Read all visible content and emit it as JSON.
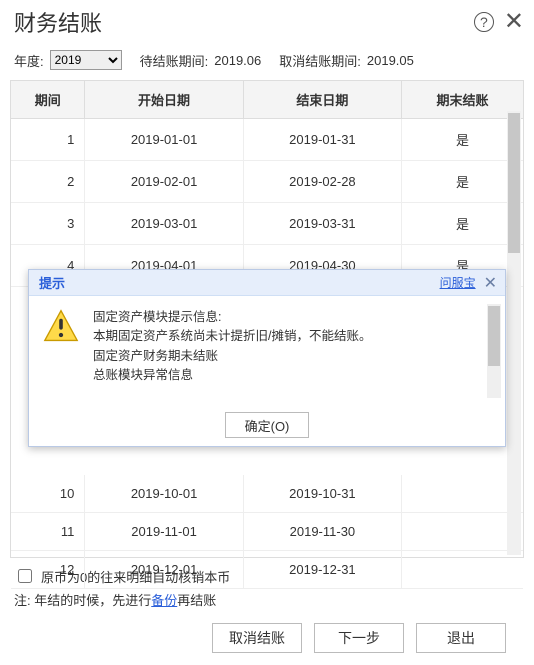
{
  "header": {
    "title": "财务结账"
  },
  "filter": {
    "year_label": "年度:",
    "year_value": "2019",
    "pending_label": "待结账期间:",
    "pending_value": "2019.06",
    "cancel_label": "取消结账期间:",
    "cancel_value": "2019.05"
  },
  "table": {
    "headers": {
      "period": "期间",
      "start": "开始日期",
      "end": "结束日期",
      "closed": "期末结账"
    },
    "rows": [
      {
        "period": "1",
        "start": "2019-01-01",
        "end": "2019-01-31",
        "closed": "是"
      },
      {
        "period": "2",
        "start": "2019-02-01",
        "end": "2019-02-28",
        "closed": "是"
      },
      {
        "period": "3",
        "start": "2019-03-01",
        "end": "2019-03-31",
        "closed": "是"
      },
      {
        "period": "4",
        "start": "2019-04-01",
        "end": "2019-04-30",
        "closed": "是"
      },
      {
        "period": "10",
        "start": "2019-10-01",
        "end": "2019-10-31",
        "closed": ""
      },
      {
        "period": "11",
        "start": "2019-11-01",
        "end": "2019-11-30",
        "closed": ""
      },
      {
        "period": "12",
        "start": "2019-12-01",
        "end": "2019-12-31",
        "closed": ""
      }
    ]
  },
  "footer": {
    "checkbox_label": "原币为0的往来明细自动核销本币",
    "note_prefix": "注:  年结的时候，先进行",
    "note_link": "备份",
    "note_suffix": "再结账",
    "buttons": {
      "cancel_close": "取消结账",
      "next": "下一步",
      "exit": "退出"
    }
  },
  "dialog": {
    "title": "提示",
    "ask_link": "问服宝",
    "lines": [
      "固定资产模块提示信息:",
      "本期固定资产系统尚未计提折旧/摊销，不能结账。",
      "固定资产财务期未结账",
      "总账模块异常信息"
    ],
    "ok_label": "确定(O)"
  }
}
